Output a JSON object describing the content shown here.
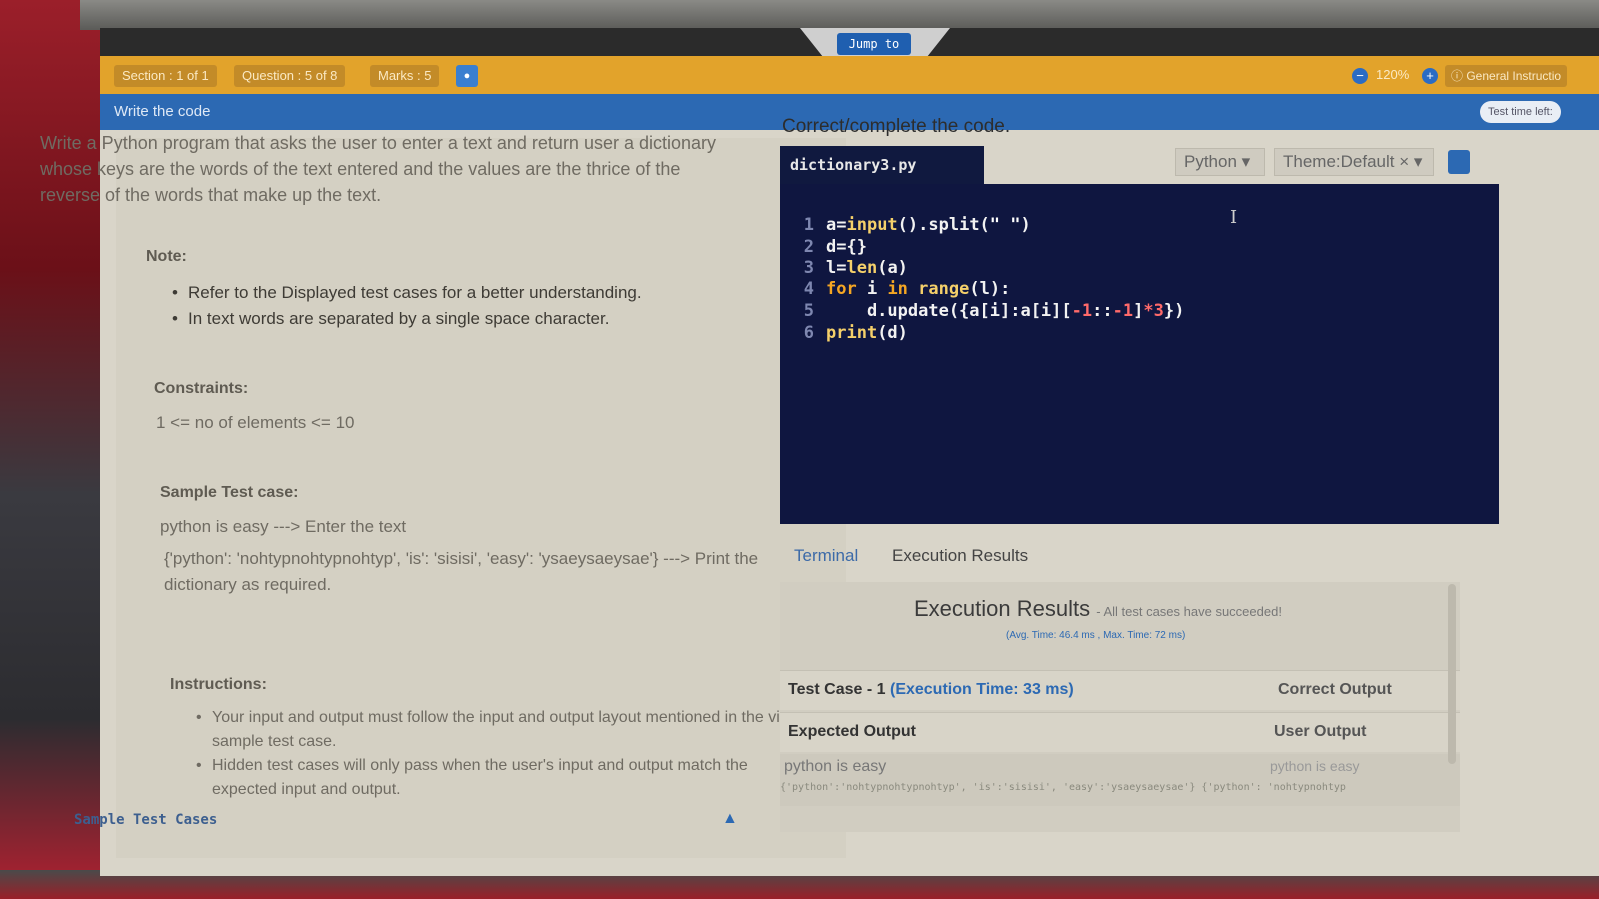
{
  "header": {
    "jump_to": "Jump to",
    "section": "Section : 1 of 1",
    "question": "Question : 5 of 8",
    "marks": "Marks : 5",
    "zoom": "120%",
    "general_instructions": "General Instructio",
    "bar_title": "Write the code",
    "time_left": "Test time left:"
  },
  "question": {
    "text": "Write a Python program that asks the user to enter a text and return user a dictionary whose keys are the words of the text entered and the values are the thrice of the reverse of the words that make up the text.",
    "note_label": "Note:",
    "notes": [
      "Refer to the Displayed test cases for a better understanding.",
      "In text words are separated by a single space character."
    ],
    "constraints_label": "Constraints:",
    "constraint": "1 <= no of elements <= 10",
    "sample_label": "Sample Test case:",
    "sample_input": "python is easy ---> Enter the text",
    "sample_output": "{'python': 'nohtypnohtypnohtyp', 'is': 'sisisi', 'easy': 'ysaeysaeysae'} ---> Print the dictionary as required.",
    "instructions_label": "Instructions:",
    "instructions": [
      "Your input and output must follow the input and output layout mentioned in the visible sample test case.",
      "Hidden test cases will only pass when the user's input and output match the expected input and output."
    ],
    "sample_test_cases": "Sample Test Cases"
  },
  "editor": {
    "heading": "Correct/complete the code.",
    "filename": "dictionary3.py",
    "language": "Python",
    "theme": "Theme:Default",
    "lines": [
      "1",
      "2",
      "3",
      "4",
      "5",
      "6"
    ]
  },
  "result_tabs": {
    "terminal": "Terminal",
    "execution": "Execution Results"
  },
  "results": {
    "title": "Execution Results",
    "subtitle": "- All test cases have succeeded!",
    "timing": "(Avg. Time: 46.4 ms , Max. Time: 72 ms)",
    "test_case": "Test Case - 1",
    "exec_time": "(Execution Time: 33 ms)",
    "correct_output": "Correct Output",
    "expected_output": "Expected Output",
    "user_output": "User Output",
    "expected_input": "python is easy",
    "user_input": "python is easy",
    "output_line": "{'python':'nohtypnohtypnohtyp', 'is':'sisisi', 'easy':'ysaeysaeysae'} {'python': 'nohtypnohtyp"
  },
  "colors": {
    "accent_orange": "#e2a32b",
    "accent_blue": "#2c69b3",
    "editor_bg": "#0f1640"
  }
}
